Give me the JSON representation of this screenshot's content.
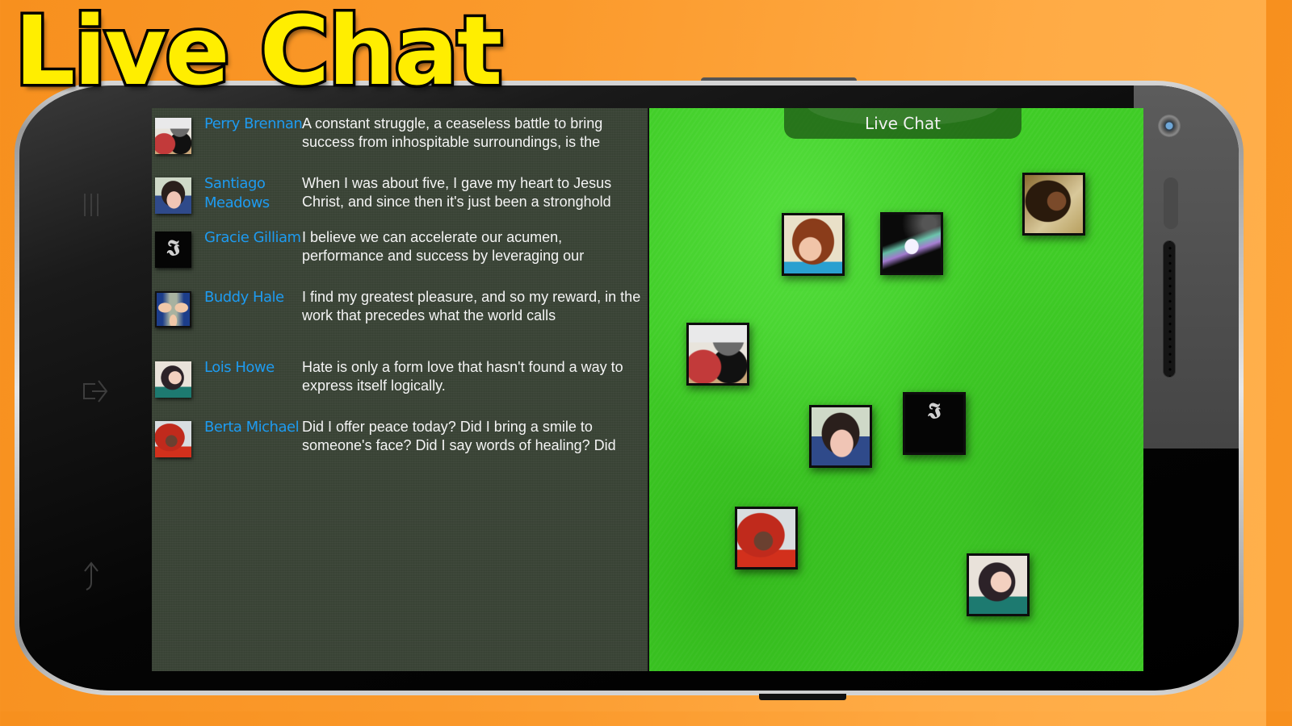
{
  "promo": {
    "title": "Live Chat"
  },
  "stage": {
    "header_title": "Live Chat"
  },
  "softkeys": [
    {
      "name": "menu",
      "icon": "menu-icon"
    },
    {
      "name": "home",
      "icon": "home-icon"
    },
    {
      "name": "back",
      "icon": "back-icon"
    }
  ],
  "colors": {
    "background": "#fb9a2c",
    "title_fill": "#ffee00",
    "name_link": "#1e9bf0",
    "chat_panel": "#3b4537",
    "stage_green": "#3fcc26",
    "message_text": "#f4f4f4"
  },
  "messages": [
    {
      "user": "Perry Brennan",
      "avatar": "shoes-photo",
      "text": "A constant struggle, a ceaseless battle to bring success from inhospitable surroundings, is the"
    },
    {
      "user": "Santiago Meadows",
      "avatar": "dark-hair-girl-photo",
      "text": "When I was about five, I gave my heart to Jesus Christ, and since then it's just been a stronghold"
    },
    {
      "user": "Gracie Gilliam",
      "avatar": "gothic-letter-logo",
      "text": "I believe we can accelerate our acumen, performance and success by leveraging our"
    },
    {
      "user": "Buddy Hale",
      "avatar": "mirrored-selfie-photo",
      "text": "I find my greatest pleasure, and so my reward, in the work that precedes what the world calls"
    },
    {
      "user": "Lois Howe",
      "avatar": "teal-shirt-girl-photo",
      "text": "Hate is only a form love that hasn't found a way to express itself logically."
    },
    {
      "user": "Berta Michael",
      "avatar": "red-hood-photo",
      "text": "Did I offer peace today? Did I bring a smile to someone's face? Did I say words of healing? Did"
    }
  ],
  "stage_avatars": [
    {
      "avatar": "redhead-girl-photo"
    },
    {
      "avatar": "pony-artwork"
    },
    {
      "avatar": "curly-hair-photo"
    },
    {
      "avatar": "shoes-photo"
    },
    {
      "avatar": "dark-hair-girl-photo"
    },
    {
      "avatar": "gothic-letter-logo"
    },
    {
      "avatar": "red-hood-photo"
    },
    {
      "avatar": "teal-shirt-girl-photo"
    }
  ]
}
